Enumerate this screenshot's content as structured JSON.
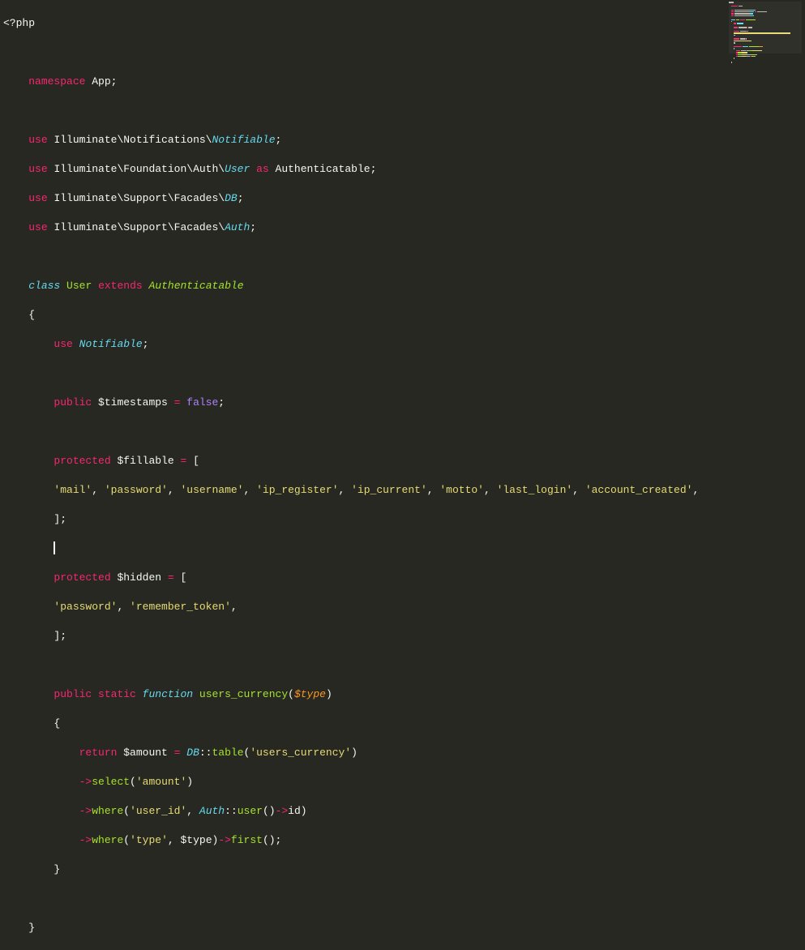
{
  "code": {
    "open_tag": "<?php",
    "kw_namespace": "namespace",
    "ns_name": "App",
    "kw_use": "use",
    "use1_path": "Illuminate\\Notifications\\",
    "use1_class": "Notifiable",
    "use2_path": "Illuminate\\Foundation\\Auth\\",
    "use2_class": "User",
    "kw_as": "as",
    "use2_alias": "Authenticatable",
    "use3_path": "Illuminate\\Support\\Facades\\",
    "use3_class": "DB",
    "use4_path": "Illuminate\\Support\\Facades\\",
    "use4_class": "Auth",
    "kw_class": "class",
    "class_name": "User",
    "kw_extends": "extends",
    "parent_class": "Authenticatable",
    "brace_open": "{",
    "brace_close": "}",
    "trait_name": "Notifiable",
    "kw_public": "public",
    "kw_protected": "protected",
    "kw_static": "static",
    "kw_function": "function",
    "kw_return": "return",
    "var_timestamps": "$timestamps",
    "eq": " = ",
    "val_false": "false",
    "semi": ";",
    "var_fillable": "$fillable",
    "arr_open": " = [",
    "arr_close": "];",
    "fillable_l1_a": "'mail'",
    "fillable_l1_b": ", ",
    "fillable_l1_c": "'password'",
    "fillable_l1_d": ", ",
    "fillable_l1_e": "'username'",
    "fillable_l1_f": ", ",
    "fillable_l1_g": "'ip_register'",
    "fillable_l1_h": ", ",
    "fillable_l1_i": "'ip_current'",
    "fillable_l1_j": ", ",
    "fillable_l1_k": "'motto'",
    "fillable_l1_l": ", ",
    "fillable_l1_m": "'last_login'",
    "fillable_l1_n": ", ",
    "fillable_l1_o": "'account_created'",
    "fillable_l1_p": ",",
    "var_hidden": "$hidden",
    "hidden_a": "'password'",
    "hidden_b": ", ",
    "hidden_c": "'remember_token'",
    "hidden_d": ",",
    "fn_name": "users_currency",
    "paren_open": "(",
    "paren_close": ")",
    "param_type": "$type",
    "var_amount": "$amount",
    "cls_db": "DB",
    "scope": "::",
    "m_table": "table",
    "str_users_currency": "'users_currency'",
    "arrow": "->",
    "m_select": "select",
    "str_amount": "'amount'",
    "m_where": "where",
    "str_user_id": "'user_id'",
    "comma_sp": ", ",
    "cls_auth": "Auth",
    "m_user": "user",
    "prop_id": "id",
    "str_type": "'type'",
    "var_type2": "$type",
    "m_first": "first",
    "empty_paren": "()"
  }
}
